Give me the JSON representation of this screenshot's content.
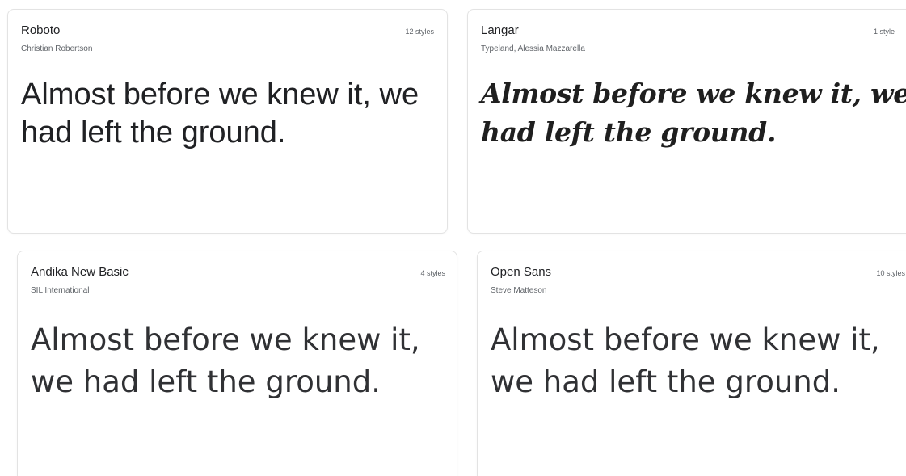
{
  "font_cards": [
    {
      "font_name": "Roboto",
      "designer": "Christian Robertson",
      "styles_count": "12 styles",
      "preview_text": "Almost before we knew it, we had left the ground."
    },
    {
      "font_name": "Langar",
      "designer": "Typeland, Alessia Mazzarella",
      "styles_count": "1 style",
      "preview_text": "Almost before we knew it, we had left the ground."
    },
    {
      "font_name": "Andika New Basic",
      "designer": "SIL International",
      "styles_count": "4 styles",
      "preview_text": "Almost before we knew it, we had left the ground."
    },
    {
      "font_name": "Open Sans",
      "designer": "Steve Matteson",
      "styles_count": "10 styles",
      "preview_text": "Almost before we knew it, we had left the ground."
    }
  ]
}
